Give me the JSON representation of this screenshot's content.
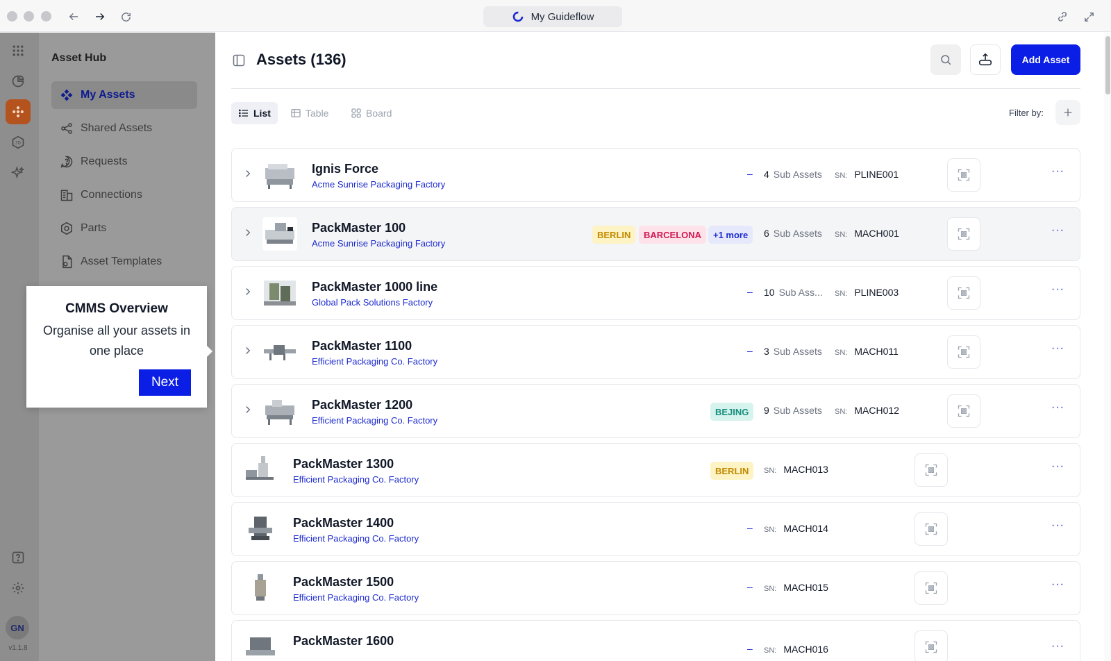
{
  "browser": {
    "tab_title": "My Guideflow"
  },
  "rail": {
    "version": "v1.1.8",
    "avatar_initials": "GN"
  },
  "nav": {
    "title": "Asset Hub",
    "items": [
      {
        "label": "My Assets",
        "icon": "diamonds-icon",
        "active": true
      },
      {
        "label": "Shared Assets",
        "icon": "share-icon"
      },
      {
        "label": "Requests",
        "icon": "question-bubble-icon"
      },
      {
        "label": "Connections",
        "icon": "building-icon"
      },
      {
        "label": "Parts",
        "icon": "hex-nut-icon"
      },
      {
        "label": "Asset Templates",
        "icon": "document-icon"
      }
    ]
  },
  "header": {
    "title": "Assets (136)",
    "add_label": "Add Asset"
  },
  "views": {
    "list": "List",
    "table": "Table",
    "board": "Board",
    "filter_label": "Filter by:"
  },
  "assets": [
    {
      "name": "Ignis Force",
      "site": "Acme Sunrise Packaging Factory",
      "dash": "–",
      "sub_count": "4",
      "sub_label": "Sub Assets",
      "sn_label": "SN:",
      "sn": "PLINE001"
    },
    {
      "name": "PackMaster 100",
      "site": "Acme Sunrise Packaging Factory",
      "tag1": "BERLIN",
      "tag2": "BARCELONA",
      "tag3": "+1 more",
      "sub_count": "6",
      "sub_label": "Sub Assets",
      "sn_label": "SN:",
      "sn": "MACH001"
    },
    {
      "name": "PackMaster 1000 line",
      "site": "Global Pack Solutions Factory",
      "dash": "–",
      "sub_count": "10",
      "sub_label": "Sub Ass...",
      "sn_label": "SN:",
      "sn": "PLINE003"
    },
    {
      "name": "PackMaster 1100",
      "site": "Efficient Packaging Co. Factory",
      "dash": "–",
      "sub_count": "3",
      "sub_label": "Sub Assets",
      "sn_label": "SN:",
      "sn": "MACH011"
    },
    {
      "name": "PackMaster 1200",
      "site": "Efficient Packaging Co. Factory",
      "tag1": "BEJING",
      "sub_count": "9",
      "sub_label": "Sub Assets",
      "sn_label": "SN:",
      "sn": "MACH012"
    },
    {
      "name": "PackMaster 1300",
      "site": "Efficient Packaging Co. Factory",
      "tag1": "BERLIN",
      "sn_label": "SN:",
      "sn": "MACH013"
    },
    {
      "name": "PackMaster 1400",
      "site": "Efficient Packaging Co. Factory",
      "dash": "–",
      "sn_label": "SN:",
      "sn": "MACH014"
    },
    {
      "name": "PackMaster 1500",
      "site": "Efficient Packaging Co. Factory",
      "dash": "–",
      "sn_label": "SN:",
      "sn": "MACH015"
    },
    {
      "name": "PackMaster 1600",
      "site": "",
      "dash": "–",
      "sn_label": "SN:",
      "sn": "MACH016"
    }
  ],
  "more_label": "···",
  "tooltip": {
    "title": "CMMS Overview",
    "body": "Organise all your assets in one place",
    "next": "Next"
  },
  "colors": {
    "primary": "#0b1ee5",
    "rail_active": "#b4531d",
    "link": "#1d2bd0"
  }
}
